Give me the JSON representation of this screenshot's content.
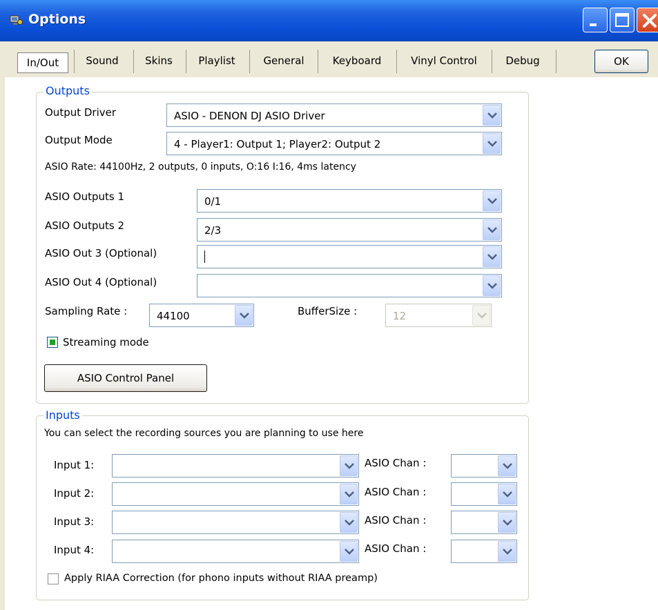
{
  "window": {
    "title": "Options"
  },
  "tabs": [
    {
      "label": "In/Out",
      "selected": true
    },
    {
      "label": "Sound"
    },
    {
      "label": "Skins"
    },
    {
      "label": "Playlist"
    },
    {
      "label": "General"
    },
    {
      "label": "Keyboard"
    },
    {
      "label": "Vinyl Control"
    },
    {
      "label": "Debug"
    }
  ],
  "ok_label": "OK",
  "outputs": {
    "title": "Outputs",
    "driver_label": "Output Driver",
    "driver_value": "ASIO - DENON DJ ASIO Driver",
    "mode_label": "Output Mode",
    "mode_value": "4 - Player1: Output 1; Player2: Output 2",
    "asio_info": "ASIO Rate: 44100Hz, 2 outputs, 0 inputs, O:16 I:16, 4ms latency",
    "out1_label": "ASIO Outputs 1",
    "out1_value": "0/1",
    "out2_label": "ASIO Outputs 2",
    "out2_value": "2/3",
    "out3_label": "ASIO Out 3 (Optional)",
    "out3_value": "",
    "out4_label": "ASIO Out 4 (Optional)",
    "out4_value": "",
    "sampling_label": "Sampling Rate :",
    "sampling_value": "44100",
    "buffer_label": "BufferSize :",
    "buffer_value": "12",
    "streaming_label": "Streaming mode",
    "streaming_checked": true,
    "control_panel_label": "ASIO Control Panel"
  },
  "inputs": {
    "title": "Inputs",
    "description": "You can select the recording sources you are planning to use here",
    "rows": [
      {
        "label": "Input 1:",
        "value": "",
        "chan_label": "ASIO Chan :",
        "chan_value": ""
      },
      {
        "label": "Input 2:",
        "value": "",
        "chan_label": "ASIO Chan :",
        "chan_value": ""
      },
      {
        "label": "Input 3:",
        "value": "",
        "chan_label": "ASIO Chan :",
        "chan_value": ""
      },
      {
        "label": "Input 4:",
        "value": "",
        "chan_label": "ASIO Chan :",
        "chan_value": ""
      }
    ],
    "riaa_label": "Apply RIAA Correction (for phono inputs without RIAA preamp)",
    "riaa_checked": false
  },
  "colors": {
    "titlebar": "#0a4fd6",
    "group_title": "#0046d5",
    "checkbox_fill": "#21a121"
  }
}
